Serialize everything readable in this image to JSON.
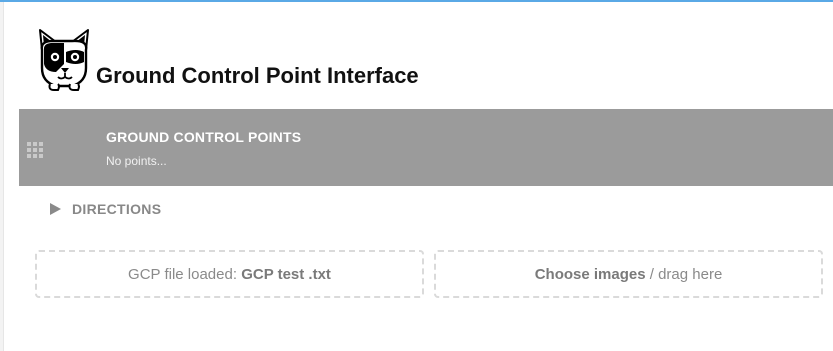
{
  "app": {
    "title": "Ground Control Point Interface",
    "logo_icon": "raccoon-logo-icon"
  },
  "colors": {
    "accent_top": "#5aa9e6",
    "panel_background": "#9b9b9b",
    "text_dark": "#111111",
    "text_muted": "#888888"
  },
  "gcp_panel": {
    "title": "GROUND CONTROL POINTS",
    "status": "No points...",
    "handle_icon": "drag-grid-icon"
  },
  "directions": {
    "label": "DIRECTIONS",
    "icon": "caret-right-icon",
    "expanded": false
  },
  "gcp_file": {
    "prefix": "GCP file loaded:",
    "filename": "GCP test .txt"
  },
  "images": {
    "action": "Choose images",
    "suffix": "/ drag here"
  }
}
